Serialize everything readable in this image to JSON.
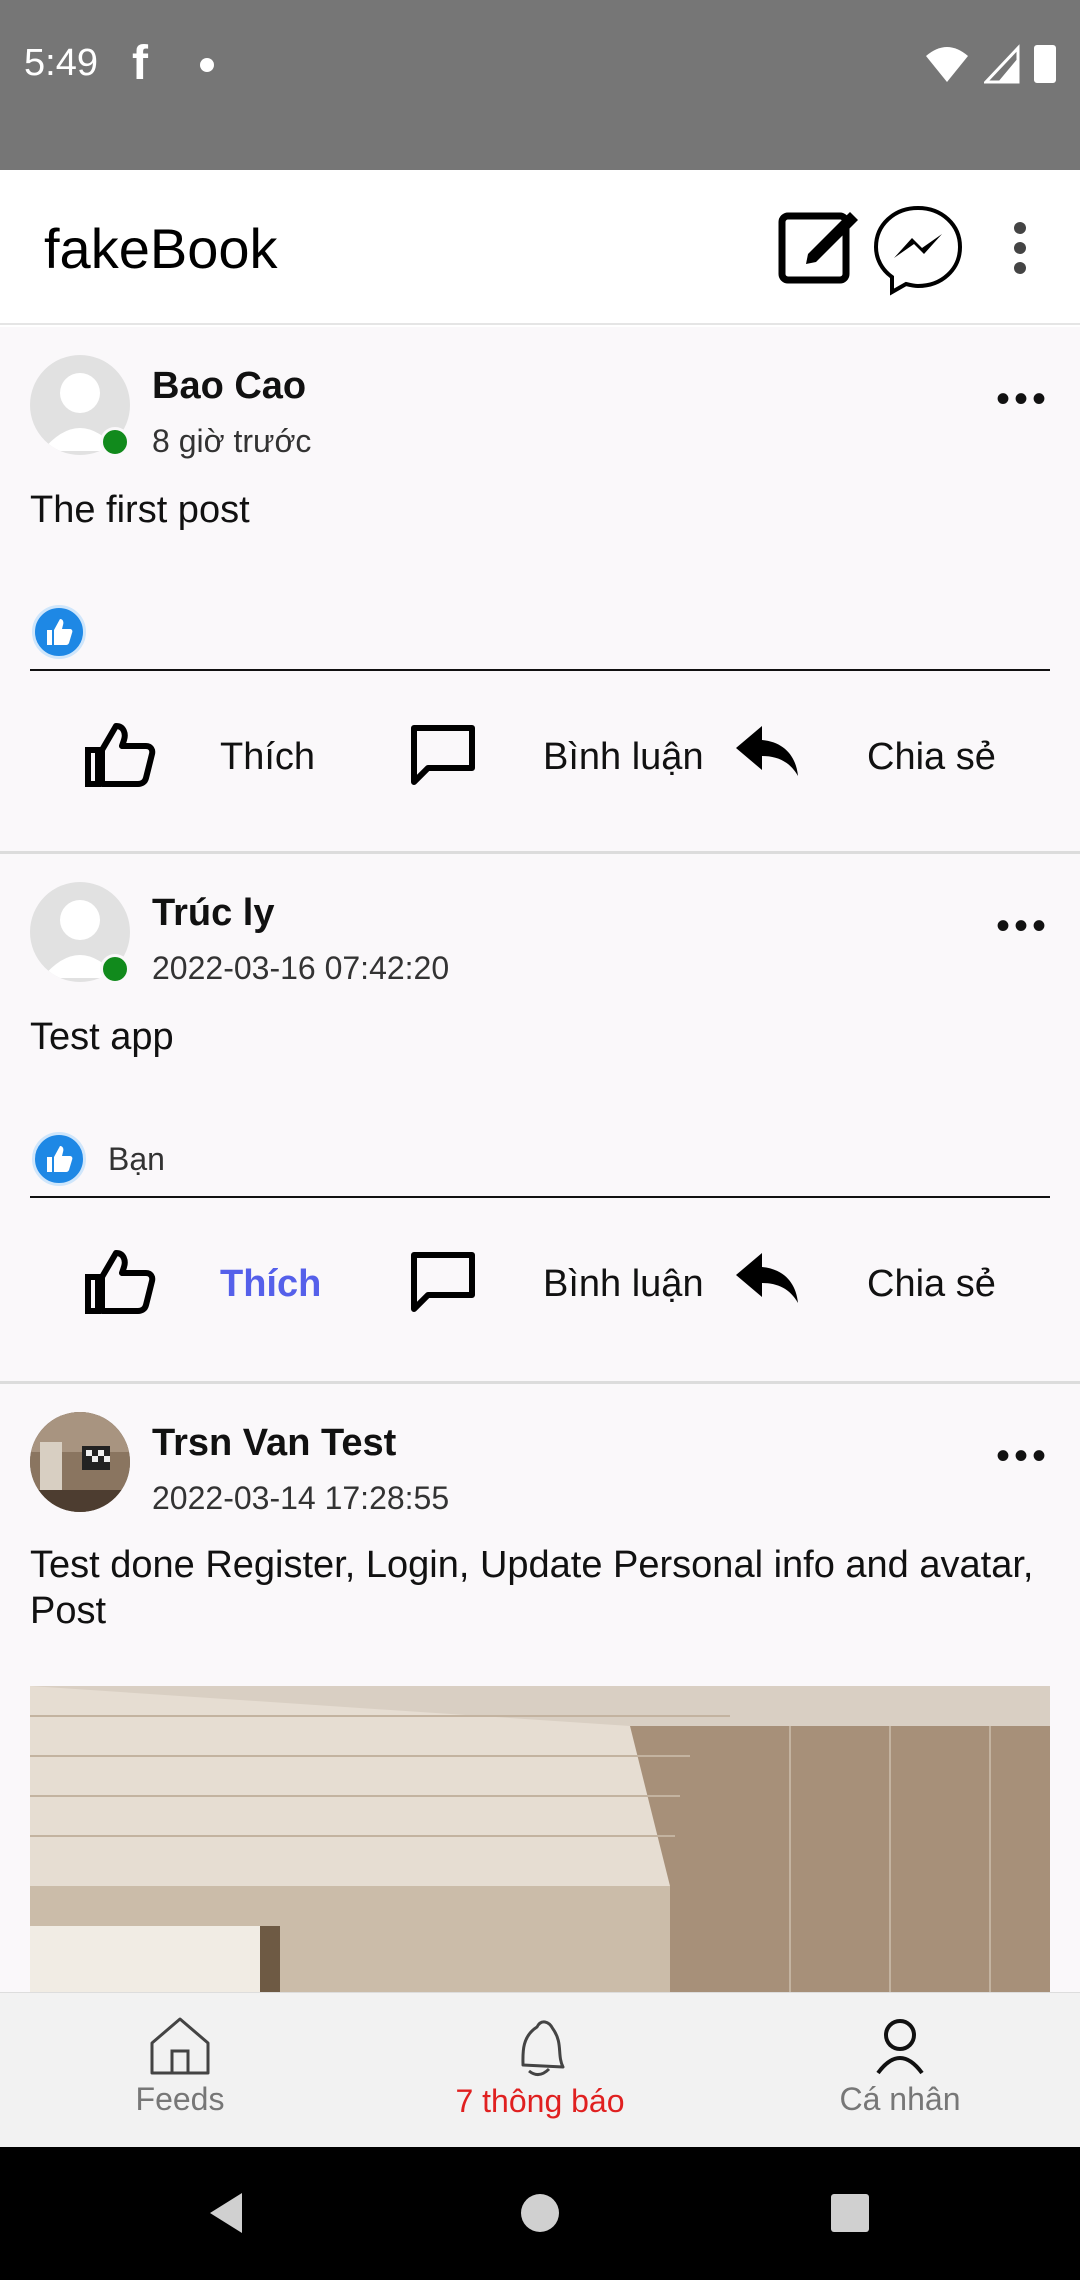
{
  "status_bar": {
    "time": "5:49",
    "fb_glyph": "f"
  },
  "app_bar": {
    "title": "fakeBook",
    "icons": [
      "compose-icon",
      "messenger-icon",
      "more-vert-icon"
    ]
  },
  "posts": [
    {
      "author": "Bao Cao",
      "time": "8 giờ trước",
      "content": "The first post",
      "online": true,
      "reaction_text": "",
      "actions": {
        "like": "Thích",
        "comment": "Bình luận",
        "share": "Chia sẻ"
      },
      "liked": false
    },
    {
      "author": "Trúc ly",
      "time": "2022-03-16 07:42:20",
      "content": "Test app",
      "online": true,
      "reaction_text": "Bạn",
      "actions": {
        "like": "Thích",
        "comment": "Bình luận",
        "share": "Chia sẻ"
      },
      "liked": true
    },
    {
      "author": "Trsn Van Test",
      "time": "2022-03-14 17:28:55",
      "content": "Test done Register, Login, Update Personal info and avatar, Post",
      "online": false
    }
  ],
  "more_glyph": "•••",
  "bottom_nav": {
    "feeds": "Feeds",
    "notifications": "7 thông báo",
    "profile": "Cá nhân",
    "active": "notifications"
  },
  "colors": {
    "status_bar": "#767676",
    "online": "#118a1c",
    "like_blue": "#1e88e5",
    "liked_label": "#5560ea",
    "nav_active": "#e02020"
  }
}
